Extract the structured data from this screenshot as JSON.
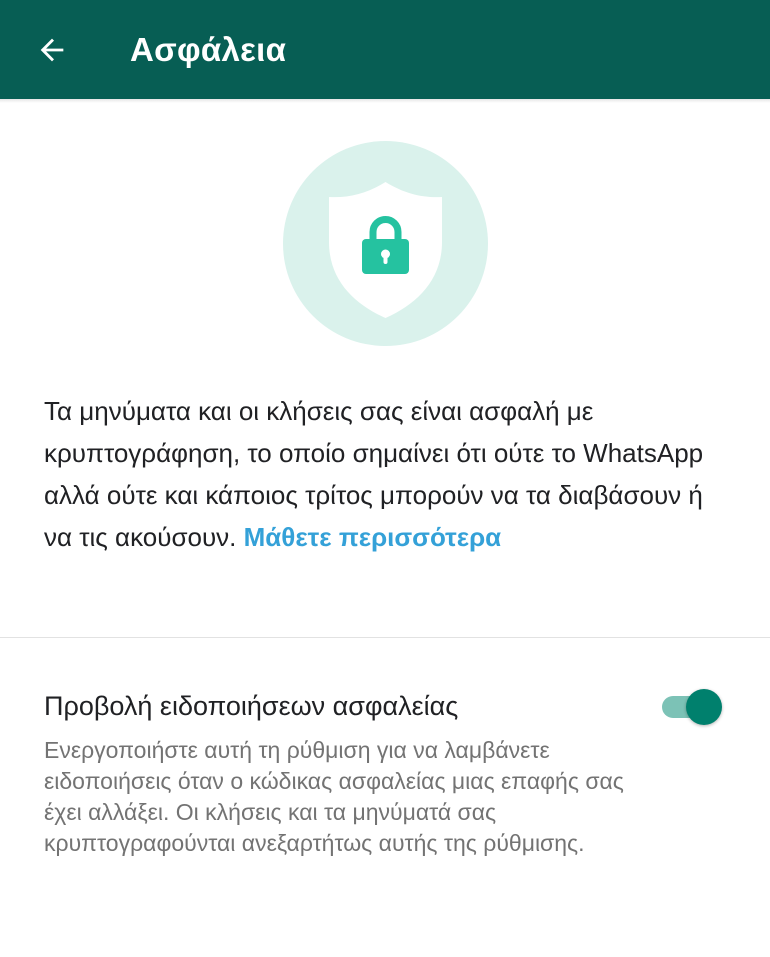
{
  "header": {
    "title": "Ασφάλεια",
    "back_icon": "arrow-left-icon"
  },
  "hero": {
    "icon": "shield-lock-icon",
    "circle_color": "#daf2ec",
    "shield_color": "#ffffff",
    "lock_color": "#25c2a0"
  },
  "description": {
    "text": "Τα μηνύματα και οι κλήσεις σας είναι ασφαλή με κρυπτογράφηση, το οποίο σημαίνει ότι ούτε το WhatsApp αλλά ούτε και κάποιος τρίτος μπορούν να τα διαβάσουν ή να τις ακούσουν.",
    "link_label": "Μάθετε περισσότερα"
  },
  "security_notifications": {
    "title": "Προβολή ειδοποιήσεων ασφαλείας",
    "subtitle": "Ενεργοποιήστε αυτή τη ρύθμιση για να λαμβάνετε ειδοποιήσεις όταν ο κώδικας ασφαλείας μιας επαφής σας έχει αλλάξει. Οι κλήσεις και τα μηνύματά σας κρυπτογραφούνται ανεξαρτήτως αυτής της ρύθμισης.",
    "enabled": true
  },
  "colors": {
    "app_bar": "#075e54",
    "accent": "#00806d",
    "link": "#34a1d8"
  }
}
